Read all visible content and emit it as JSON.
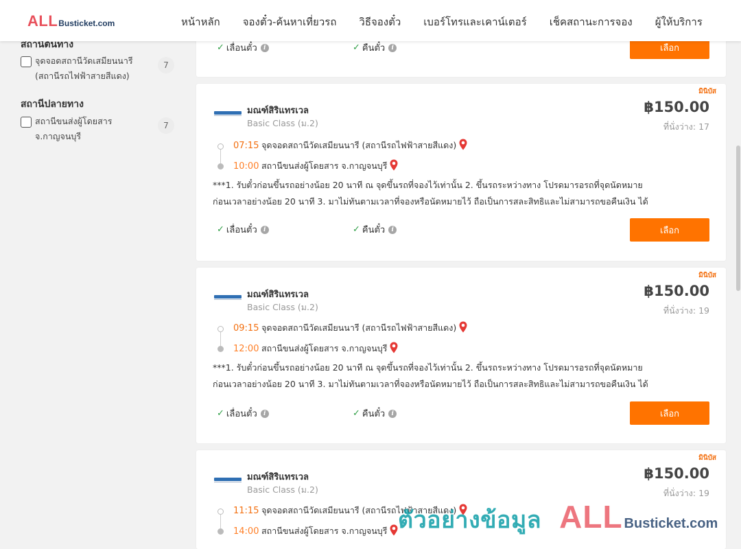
{
  "header": {
    "logo_primary": "ALL",
    "logo_secondary": "Busticket.com",
    "nav": [
      "หน้าหลัก",
      "จองตั๋ว-ค้นหาเที่ยวรถ",
      "วิธีจองตั๋ว",
      "เบอร์โทรและเคาน์เตอร์",
      "เช็คสถานะการจอง",
      "ผู้ให้บริการ"
    ]
  },
  "sidebar": {
    "origin_title": "สถานีต้นทาง",
    "origin_option": {
      "label": "จุดจอดสถานีวัดเสมียนนารี (สถานีรถไฟฟ้าสายสีแดง)",
      "count": "7"
    },
    "dest_title": "สถานีปลายทาง",
    "dest_option": {
      "label": "สถานีขนส่งผู้โดยสาร จ.กาญจนบุรี",
      "count": "7"
    }
  },
  "labels": {
    "reschedule": "เลื่อนตั๋ว",
    "refund": "คืนตั๋ว",
    "select": "เลือก",
    "seats_prefix": "ที่นั่งว่าง:"
  },
  "trips": [
    {
      "badge": "มินิบัส",
      "operator": "มณฑ์สิริแทรเวล",
      "bus_class": "Basic Class (ม.2)",
      "price": "฿150.00",
      "seats": "17",
      "depart_time": "07:15",
      "depart_station": "จุดจอดสถานีวัดเสมียนนารี (สถานีรถไฟฟ้าสายสีแดง)",
      "arrive_time": "10:00",
      "arrive_station": "สถานีขนส่งผู้โดยสาร จ.กาญจนบุรี",
      "description": "***1. รับตั๋วก่อนขึ้นรถอย่างน้อย 20 นาที ณ จุดขึ้นรถที่จองไว้เท่านั้น 2. ขึ้นรถระหว่างทาง โปรดมารอรถที่จุดนัดหมาย\nก่อนเวลาอย่างน้อย 20 นาที 3. มาไม่ทันตามเวลาที่จองหรือนัดหมายไว้ ถือเป็นการสละสิทธิและไม่สามารถขอคืนเงิน ได้"
    },
    {
      "badge": "มินิบัส",
      "operator": "มณฑ์สิริแทรเวล",
      "bus_class": "Basic Class (ม.2)",
      "price": "฿150.00",
      "seats": "19",
      "depart_time": "09:15",
      "depart_station": "จุดจอดสถานีวัดเสมียนนารี (สถานีรถไฟฟ้าสายสีแดง)",
      "arrive_time": "12:00",
      "arrive_station": "สถานีขนส่งผู้โดยสาร จ.กาญจนบุรี",
      "description": "***1. รับตั๋วก่อนขึ้นรถอย่างน้อย 20 นาที ณ จุดขึ้นรถที่จองไว้เท่านั้น 2. ขึ้นรถระหว่างทาง โปรดมารอรถที่จุดนัดหมาย\nก่อนเวลาอย่างน้อย 20 นาที 3. มาไม่ทันตามเวลาที่จองหรือนัดหมายไว้ ถือเป็นการสละสิทธิและไม่สามารถขอคืนเงิน ได้"
    },
    {
      "badge": "มินิบัส",
      "operator": "มณฑ์สิริแทรเวล",
      "bus_class": "Basic Class (ม.2)",
      "price": "฿150.00",
      "seats": "19",
      "depart_time": "11:15",
      "depart_station": "จุดจอดสถานีวัดเสมียนนารี (สถานีรถไฟฟ้าสายสีแดง)",
      "arrive_time": "14:00",
      "arrive_station": "สถานีขนส่งผู้โดยสาร จ.กาญจนบุรี"
    }
  ],
  "watermark": {
    "text": "ตัวอย่างข้อมูล",
    "brand_primary": "ALL",
    "brand_secondary": "Busticket.com"
  },
  "colors": {
    "accent": "#ff7300",
    "time": "#f36f0f",
    "check": "#2e9e45",
    "pin": "#e53935",
    "logo": "#e8505b"
  }
}
